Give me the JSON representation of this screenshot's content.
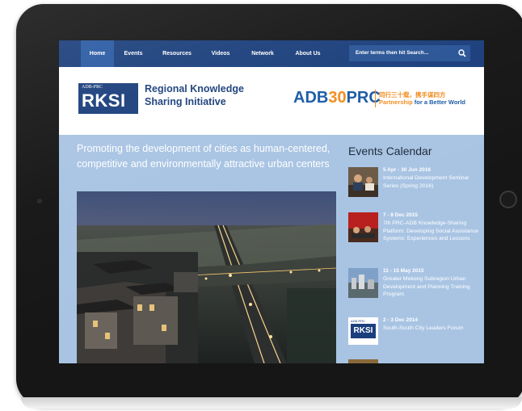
{
  "nav": {
    "items": [
      "Home",
      "Events",
      "Resources",
      "Videos",
      "Network",
      "About Us"
    ],
    "search_placeholder": "Enter terms then hit Search..."
  },
  "header": {
    "logo_small": "ADB-PRC",
    "logo_big": "RKSI",
    "site_name_line1": "Regional Knowledge",
    "site_name_line2": "Sharing Initiative",
    "partner_logo_pre": "ADB",
    "partner_logo_num": "30",
    "partner_logo_post": "PRC",
    "partner_tag_cn": "同行三十载，携手谋四方",
    "partner_tag_en_1": "Partnership",
    "partner_tag_en_2": "for a Better World"
  },
  "feature": {
    "title": "Promoting the development of cities as human-centered, competitive and environmentally attractive urban centers"
  },
  "events": {
    "heading": "Events Calendar",
    "items": [
      {
        "date": "5 Apr - 30 Jun 2016",
        "title": "International Development Seminar Series (Spring 2016)"
      },
      {
        "date": "7 - 8 Dec 2015",
        "title": "7th PRC-ADB Knowledge-Sharing Platform: Developing Social Assistance Systems: Experiences and Lessons"
      },
      {
        "date": "11 - 15 May 2015",
        "title": "Greater Mekong Subregion Urban Development and Planning Training Program"
      },
      {
        "date": "2 - 3 Dec 2014",
        "title": "South-South City Leaders Forum"
      }
    ],
    "rksi_thumb_small": "ADB-PRC",
    "rksi_thumb_big": "RKSI"
  },
  "colors": {
    "nav_bg": "#1b3f7c",
    "accent_orange": "#f28c1e",
    "main_bg": "#a9c4e3"
  }
}
